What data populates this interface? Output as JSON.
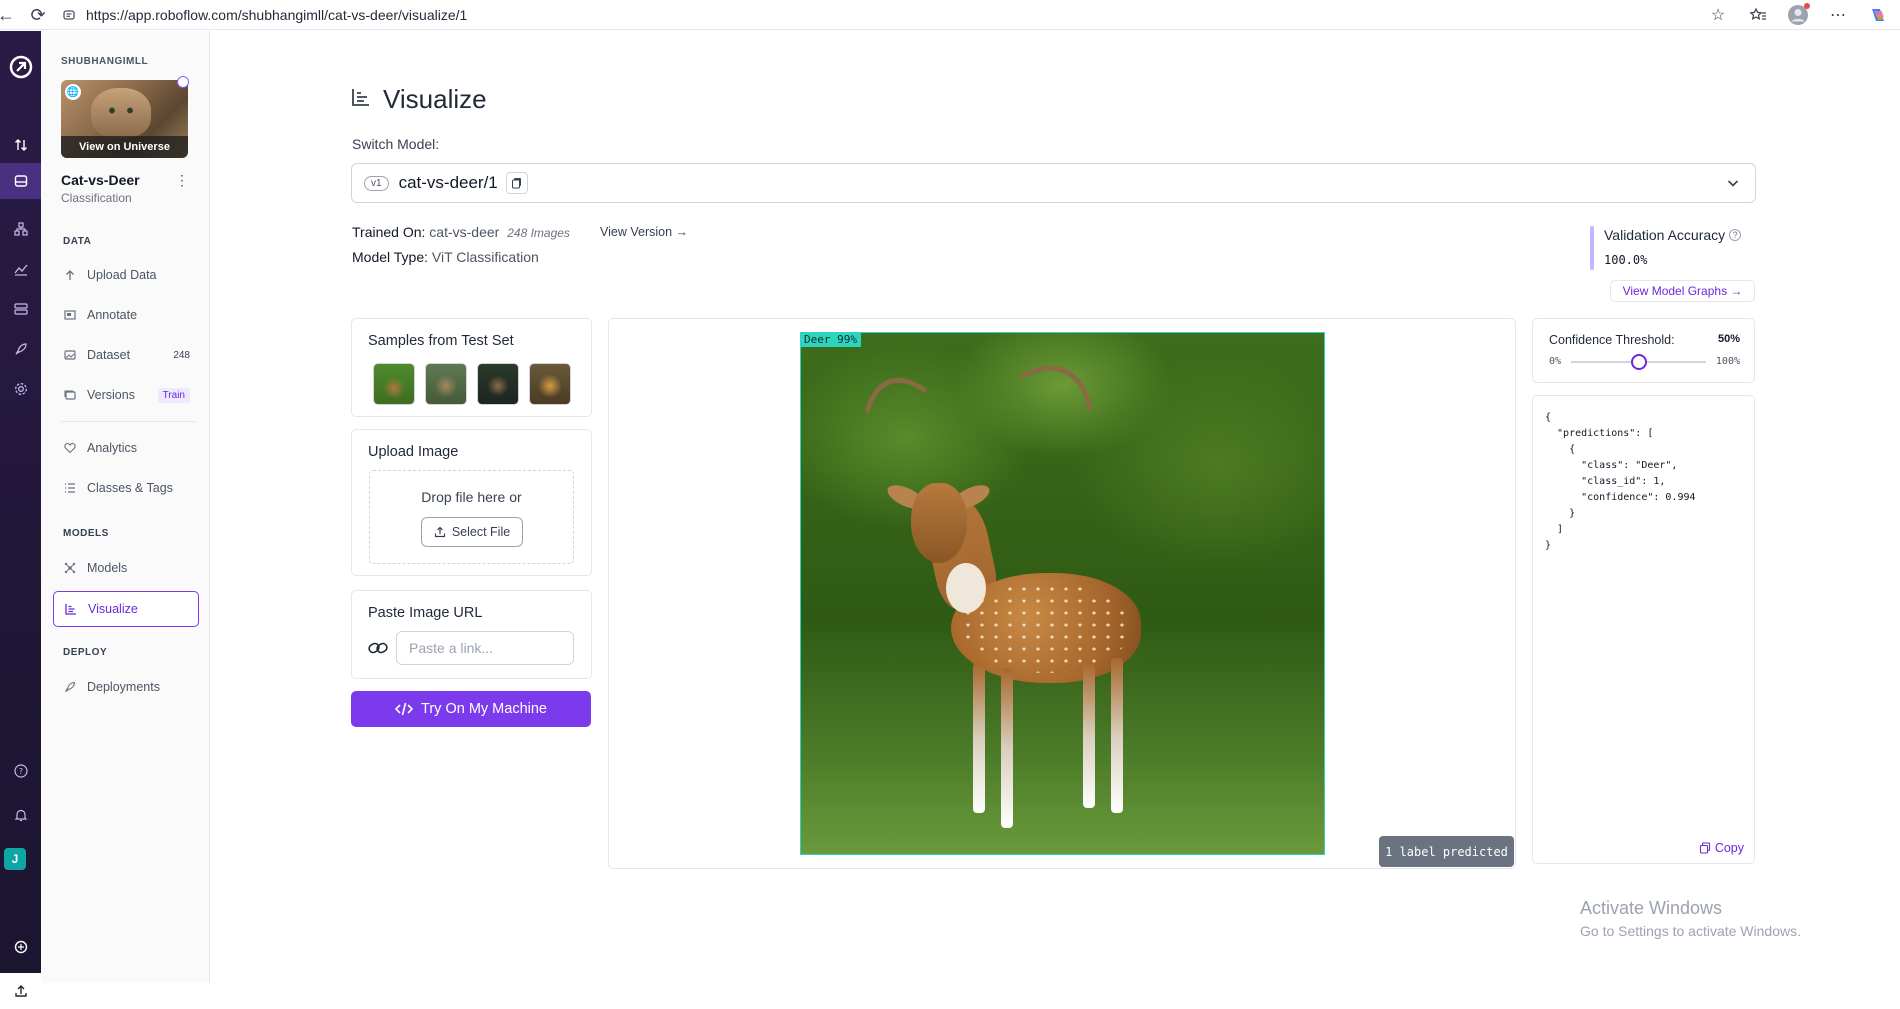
{
  "browser": {
    "url": "https://app.roboflow.com/shubhangimll/cat-vs-deer/visualize/1"
  },
  "rail": {
    "avatar_letter": "J"
  },
  "sidebar": {
    "workspace": "SHUBHANGIMLL",
    "view_universe": "View on Universe",
    "project_name": "Cat-vs-Deer",
    "project_type": "Classification",
    "sections": {
      "data": "DATA",
      "models": "MODELS",
      "deploy": "DEPLOY"
    },
    "items": {
      "upload": "Upload Data",
      "annotate": "Annotate",
      "dataset": "Dataset",
      "dataset_count": "248",
      "versions": "Versions",
      "versions_badge": "Train",
      "analytics": "Analytics",
      "classes": "Classes & Tags",
      "models": "Models",
      "visualize": "Visualize",
      "deployments": "Deployments"
    }
  },
  "main": {
    "title": "Visualize",
    "switch_label": "Switch Model:",
    "version_chip": "v1",
    "model_name": "cat-vs-deer/1",
    "trained_on_label": "Trained On:",
    "trained_on_value": "cat-vs-deer",
    "image_count": "248 Images",
    "view_version": "View Version →",
    "model_type_label": "Model Type:",
    "model_type_value": "ViT Classification",
    "val_acc_label": "Validation Accuracy",
    "val_acc_value": "100.0%",
    "view_graphs": "View Model Graphs →"
  },
  "samples": {
    "title": "Samples from Test Set"
  },
  "upload": {
    "title": "Upload Image",
    "drop_text": "Drop file here or",
    "select_file": "Select File"
  },
  "paste": {
    "title": "Paste Image URL",
    "placeholder": "Paste a link..."
  },
  "try_button": "Try On My Machine",
  "prediction": {
    "bbox_label": "Deer 99%",
    "chip": "1 label predicted"
  },
  "confidence": {
    "label": "Confidence Threshold:",
    "value": "50%",
    "value_fraction": 0.5,
    "min": "0%",
    "max": "100%"
  },
  "json_output": "{\n  \"predictions\": [\n    {\n      \"class\": \"Deer\",\n      \"class_id\": 1,\n      \"confidence\": 0.994\n    }\n  ]\n}",
  "copy_label": "Copy",
  "windows": {
    "line1": "Activate Windows",
    "line2": "Go to Settings to activate Windows."
  }
}
